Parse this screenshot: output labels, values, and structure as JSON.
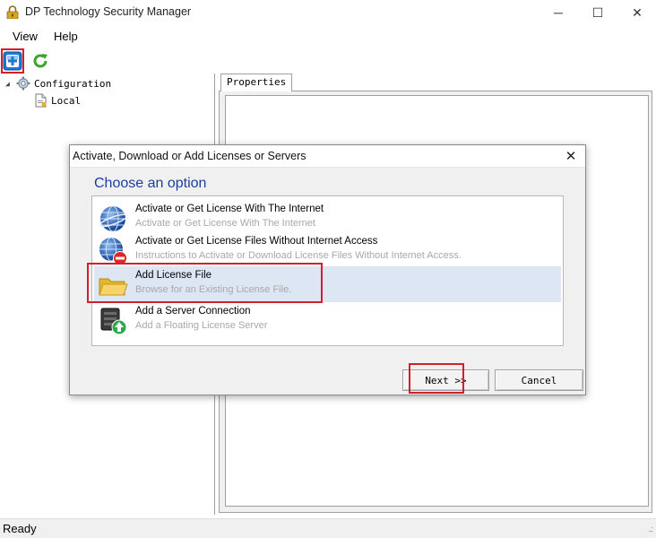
{
  "window": {
    "title": "DP Technology Security Manager",
    "controls": {
      "minimize": "─",
      "maximize": "☐",
      "close": "✕"
    }
  },
  "menu": {
    "view": "View",
    "help": "Help"
  },
  "toolbar": {
    "add_icon": "add-icon",
    "refresh_icon": "refresh-icon"
  },
  "tree": {
    "root": {
      "label": "Configuration",
      "icon": "gear-icon",
      "expanded": true
    },
    "child": {
      "label": "Local",
      "icon": "document-icon"
    }
  },
  "properties": {
    "tab_label": "Properties"
  },
  "status": {
    "text": "Ready",
    "grip": "..:"
  },
  "dialog": {
    "title": "Activate, Download or Add Licenses or Servers",
    "close": "✕",
    "heading": "Choose an option",
    "options": [
      {
        "title": "Activate or Get License With The Internet",
        "subtitle": "Activate or Get License With The Internet",
        "icon": "globe-icon",
        "selected": false
      },
      {
        "title": "Activate or Get License Files Without Internet Access",
        "subtitle": "Instructions to Activate or Download License Files Without Internet Access.",
        "icon": "globe-blocked-icon",
        "selected": false
      },
      {
        "title": "Add License File",
        "subtitle": "Browse for an Existing License File.",
        "icon": "folder-icon",
        "selected": true
      },
      {
        "title": "Add a Server Connection",
        "subtitle": "Add a Floating License Server",
        "icon": "server-connection-icon",
        "selected": false
      }
    ],
    "next_label": "Next >>",
    "cancel_label": "Cancel"
  },
  "colors": {
    "highlight_box": "#d0202a",
    "heading": "#1a3fa0",
    "selected_row": "#dce7f3",
    "subtitle_text": "#a8a8a8"
  }
}
